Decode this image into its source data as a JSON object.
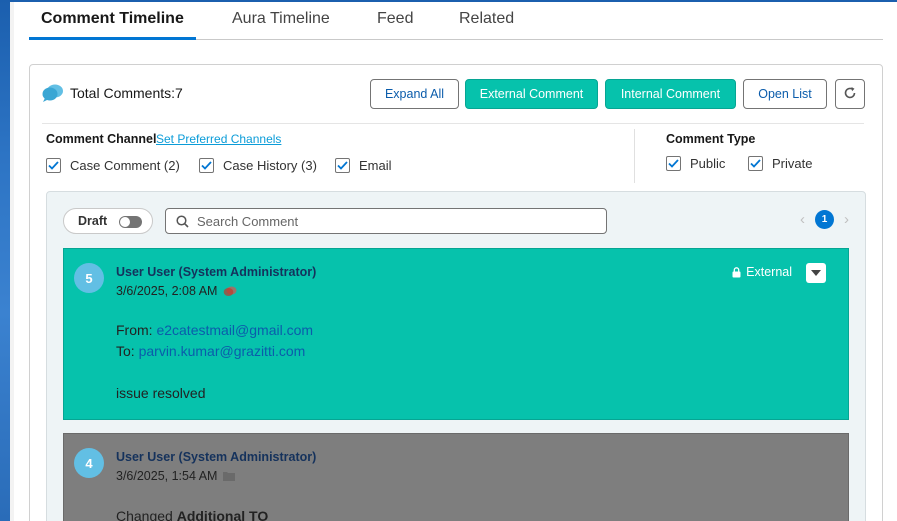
{
  "tabs": [
    {
      "label": "Comment Timeline",
      "active": true
    },
    {
      "label": "Aura Timeline",
      "active": false
    },
    {
      "label": "Feed",
      "active": false
    },
    {
      "label": "Related",
      "active": false
    }
  ],
  "header": {
    "total_label": "Total Comments:",
    "total_count": "7",
    "buttons": {
      "expand_all": "Expand All",
      "external_comment": "External Comment",
      "internal_comment": "Internal Comment",
      "open_list": "Open List",
      "refresh_icon": "refresh-icon"
    }
  },
  "filters": {
    "channel_label": "Comment Channel",
    "set_preferred_link": "Set Preferred Channels",
    "channels": [
      {
        "label": "Case Comment (2)",
        "checked": true
      },
      {
        "label": "Case History (3)",
        "checked": true
      },
      {
        "label": "Email",
        "checked": true
      }
    ],
    "type_label": "Comment Type",
    "types": [
      {
        "label": "Public",
        "checked": true
      },
      {
        "label": "Private",
        "checked": true
      }
    ]
  },
  "toolbar": {
    "draft_label": "Draft",
    "draft_on": false,
    "search_placeholder": "Search Comment",
    "current_page": "1"
  },
  "comments": [
    {
      "number": "5",
      "author": "User User (System Administrator)",
      "date": "3/6/2025, 2:08 AM",
      "visibility": "External",
      "from_label": "From:",
      "from_value": "e2catestmail@gmail.com",
      "to_label": "To:",
      "to_value": "parvin.kumar@grazitti.com",
      "text": "issue resolved",
      "color": "#06c2ac"
    },
    {
      "number": "4",
      "author": "User User (System Administrator)",
      "date": "3/6/2025, 1:54 AM",
      "text_prefix": "Changed ",
      "text_bold": "Additional TO",
      "color": "#7e7e7e"
    }
  ],
  "colors": {
    "accent": "#0176d3",
    "teal": "#06c2ac",
    "link": "#0b5cab"
  }
}
